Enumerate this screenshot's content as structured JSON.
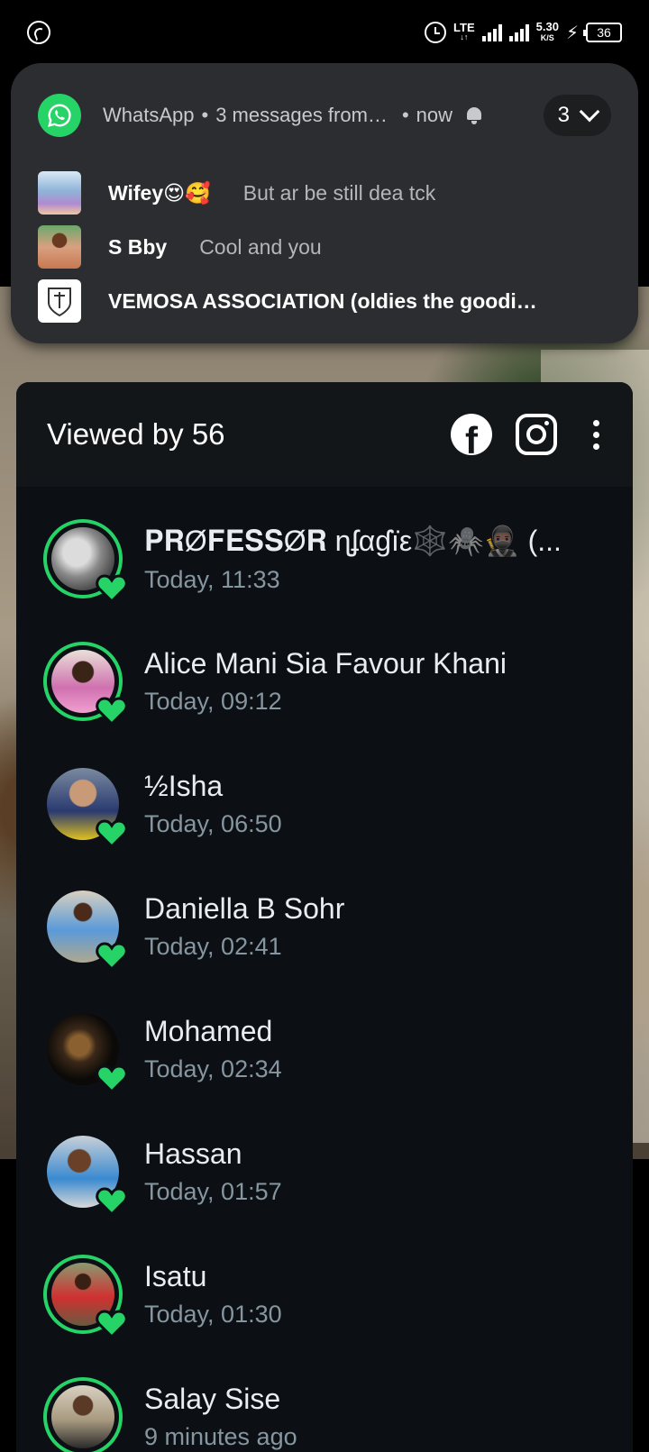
{
  "status_bar": {
    "network": "LTE",
    "network_sub": "↓↑",
    "speed": "5.30",
    "speed_unit": "K/S",
    "battery": "36"
  },
  "notification": {
    "app": "WhatsApp",
    "summary": "3 messages from…",
    "time": "now",
    "count": "3",
    "messages": [
      {
        "name": "Wifey😍🥰",
        "text": "But ar be still dea tck"
      },
      {
        "name": "S Bby",
        "text": "Cool and you"
      },
      {
        "name": "VEMOSA ASSOCIATION (oldies the goodi…",
        "text": ""
      }
    ]
  },
  "sheet": {
    "title": "Viewed by 56",
    "viewers": [
      {
        "name": "𝐏𝐑Ø𝐅𝐄𝐒𝐒Ø𝐑 ɳʄαɠïε🕸️🕷️🥷🏿 (...",
        "time": "Today, 11:33",
        "ring": true
      },
      {
        "name": "Alice Mani Sia Favour Khani",
        "time": "Today, 09:12",
        "ring": true
      },
      {
        "name": "½Isha",
        "time": "Today, 06:50",
        "ring": false
      },
      {
        "name": "Daniella B Sohr",
        "time": "Today, 02:41",
        "ring": false
      },
      {
        "name": "Mohamed",
        "time": "Today, 02:34",
        "ring": false
      },
      {
        "name": "Hassan",
        "time": "Today, 01:57",
        "ring": false
      },
      {
        "name": "Isatu",
        "time": "Today, 01:30",
        "ring": true
      },
      {
        "name": "Salay Sise",
        "time": "9 minutes ago",
        "ring": true
      }
    ]
  },
  "colors": {
    "accent": "#25d366",
    "sheet_bg": "#0c1014",
    "header_bg": "#121619",
    "notification_bg": "#2b2d30",
    "secondary_text": "#8696a0"
  },
  "icons": [
    "whatsapp-icon",
    "alarm-icon",
    "signal-icon",
    "charging-icon",
    "battery-icon",
    "bell-icon",
    "chevron-down-icon",
    "facebook-icon",
    "instagram-icon",
    "more-options-icon",
    "heart-icon"
  ]
}
